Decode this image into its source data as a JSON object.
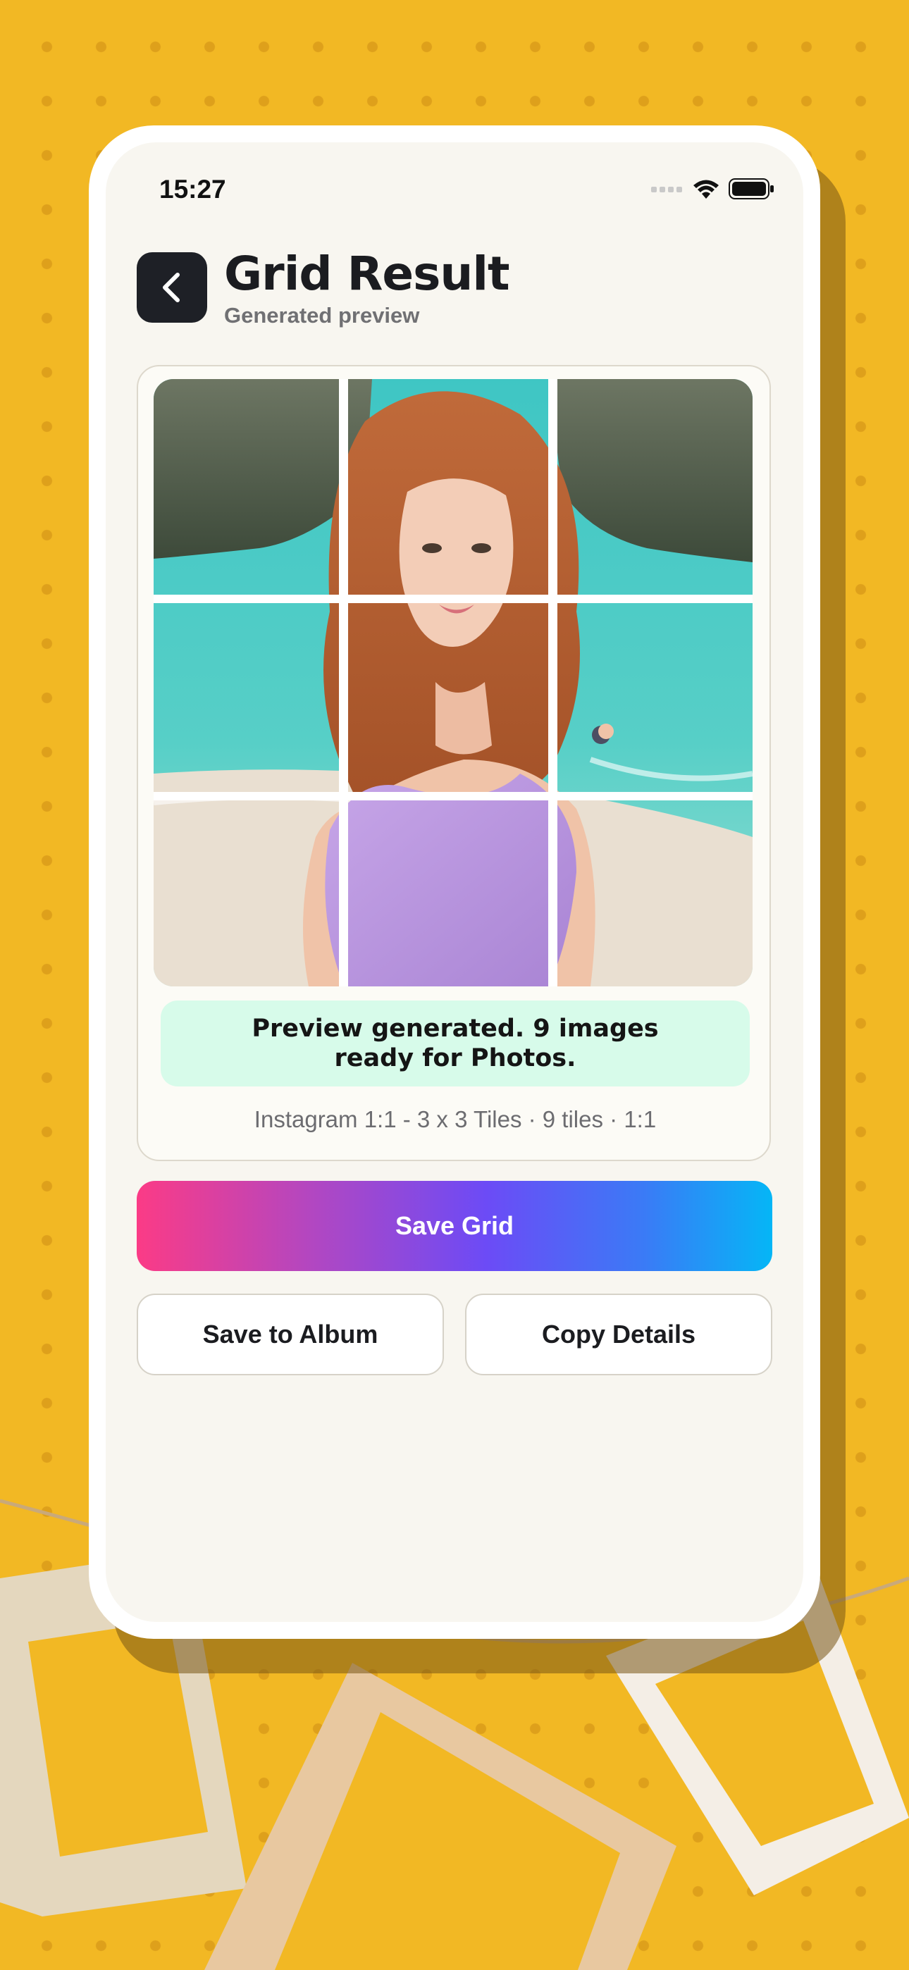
{
  "status_bar": {
    "time": "15:27"
  },
  "header": {
    "title": "Grid Result",
    "subtitle": "Generated preview"
  },
  "preview": {
    "rows": 3,
    "columns": 3,
    "tiles": [
      {
        "row": 1,
        "col": 1
      },
      {
        "row": 1,
        "col": 2
      },
      {
        "row": 1,
        "col": 3
      },
      {
        "row": 2,
        "col": 1
      },
      {
        "row": 2,
        "col": 2
      },
      {
        "row": 2,
        "col": 3
      },
      {
        "row": 3,
        "col": 1
      },
      {
        "row": 3,
        "col": 2
      },
      {
        "row": 3,
        "col": 3
      }
    ],
    "notice": "Preview generated. 9 images ready for Photos.",
    "meta": "Instagram 1:1 - 3 x 3 Tiles · 9 tiles · 1:1"
  },
  "actions": {
    "save_grid": "Save Grid",
    "save_to_album": "Save to Album",
    "copy_details": "Copy Details"
  },
  "colors": {
    "background": "#F2B824",
    "dark_button": "#1E2026",
    "notice_bg": "#D7FBEA",
    "gradient_start": "#FB3B86",
    "gradient_mid": "#6C4BF6",
    "gradient_end": "#05B6F6"
  },
  "icons": {
    "back": "chevron-left-icon",
    "signal": "cellular-signal-icon",
    "wifi": "wifi-icon",
    "battery": "battery-icon"
  }
}
